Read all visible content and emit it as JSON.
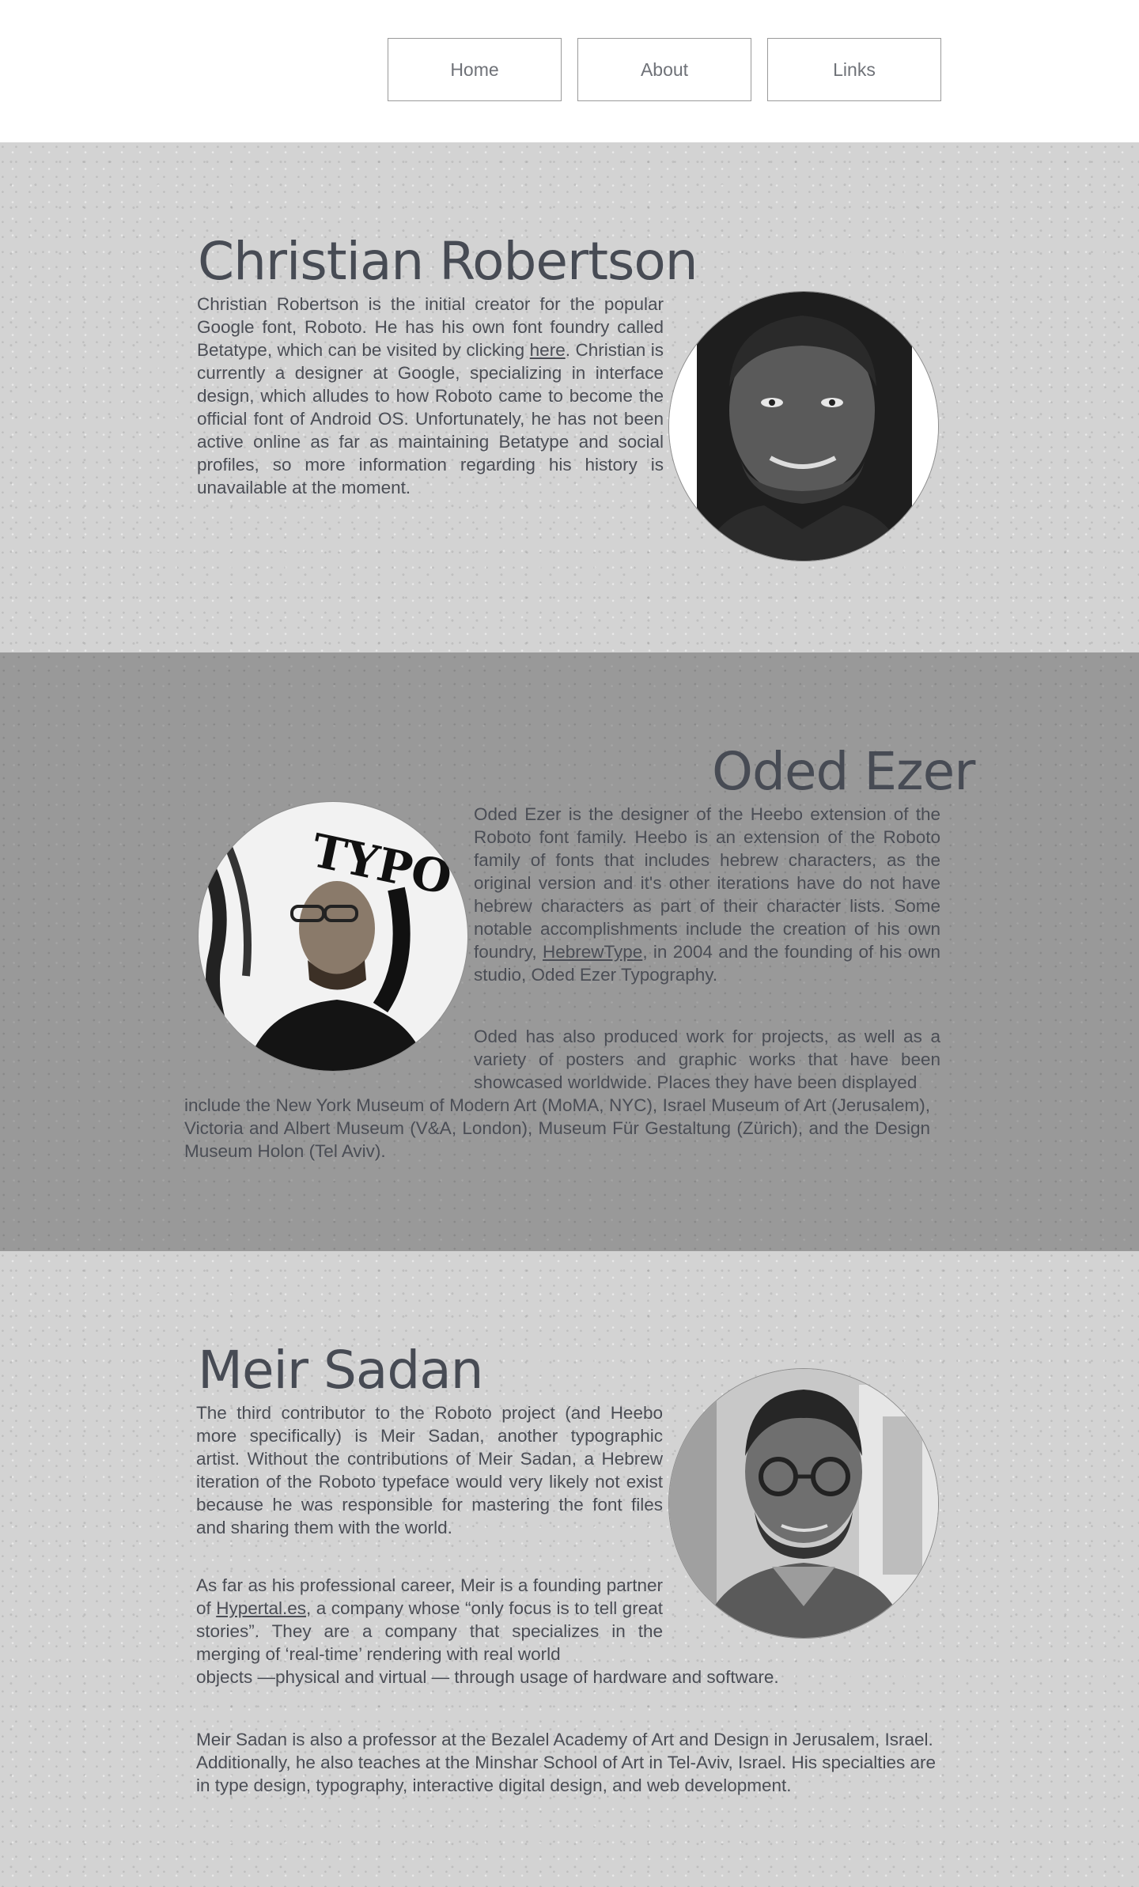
{
  "nav": {
    "items": [
      {
        "label": "Home"
      },
      {
        "label": "About"
      },
      {
        "label": "Links"
      }
    ]
  },
  "sections": {
    "robertson": {
      "name": "Christian Robertson",
      "bio_part1": "Christian Robertson is the initial creator for the popular Google font, Roboto. He has his own font foundry called Betatype, which can be visited by clicking ",
      "link_text": "here",
      "bio_part2": ". Christian is currently a designer at Google, specializing in interface design, which alludes to how Roboto came to become the official font of Android OS. Unfortunately, he has not been active online as far as maintaining Betatype and social profiles, so more information regarding his history is unavailable at the moment.",
      "photo_icon": "portrait-photo"
    },
    "ezer": {
      "name": "Oded Ezer",
      "bio1_part1": "Oded Ezer is the designer of the Heebo extension of the Roboto font family. Heebo is an extension of the Roboto family of fonts that includes hebrew characters, as the original version and it's other iterations have do not have hebrew characters as part of their character lists. Some notable accomplishments include the creation of his own foundry, ",
      "link_text": "HebrewType",
      "bio1_part2": ", in 2004 and the founding of his own studio, Oded Ezer Typography.",
      "bio2": "Oded has also produced work for projects, as well as a variety of posters and graphic works that have been showcased worldwide. Places they have been displayed",
      "bio3": "include the New York Museum of Modern Art (MoMA,   NYC), Israel Museum of Art (Jerusalem), Victoria and Albert Museum (V&A, London), Museum Für Gestaltung (Zürich), and the Design Museum Holon (Tel Aviv).",
      "photo_icon": "portrait-photo"
    },
    "sadan": {
      "name": "Meir Sadan",
      "bio1": "The third contributor to the Roboto project (and Heebo more specifically) is Meir Sadan, another typographic artist. Without the contributions of Meir Sadan, a Hebrew iteration  of the Roboto typeface would very likely not exist because he was responsible for mastering the font files and sharing them with the world.",
      "bio2_part1": "As far as his professional career, Meir is a founding partner of ",
      "link_text": "Hypertal.es",
      "bio2_part2": ", a company whose “only focus is to tell great stories”. They are a company that specializes in the merging of ‘real-time’ rendering with real world",
      "bio2_tail": "objects —physical and virtual — through usage of hardware and software.",
      "bio3": "Meir Sadan is also a professor at  the Bezalel Academy of Art and Design in Jerusalem, Israel. Additionally, he also teaches at the Minshar School of Art in Tel-Aviv, Israel. His specialties are in type design, typography, interactive digital design, and web development.",
      "photo_icon": "portrait-photo"
    }
  }
}
